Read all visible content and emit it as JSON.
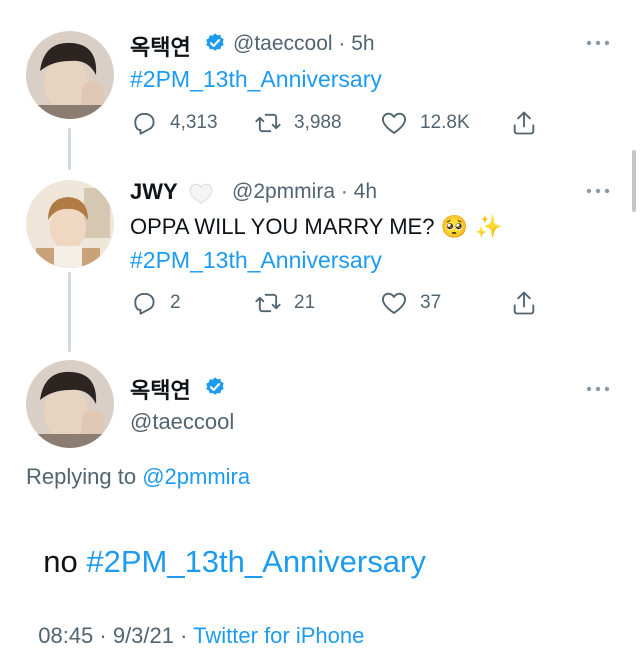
{
  "tweet1": {
    "name": "옥택연",
    "handle_time": "@taeccool · 5h",
    "hashtag": "#2PM_13th_Anniversary",
    "replies": "4,313",
    "retweets": "3,988",
    "likes": "12.8K"
  },
  "tweet2": {
    "name": "JWY",
    "handle_time": "@2pmmira · 4h",
    "text": "OPPA WILL YOU MARRY ME?",
    "emoji": "🥺 ✨",
    "hashtag": "#2PM_13th_Anniversary",
    "replies": "2",
    "retweets": "21",
    "likes": "37"
  },
  "main": {
    "name": "옥택연",
    "handle": "@taeccool",
    "replying_prefix": "Replying to ",
    "replying_handle": "@2pmmira",
    "text_prefix": "no ",
    "hashtag": "#2PM_13th_Anniversary",
    "time": "08:45 · 9/3/21 · ",
    "source": "Twitter for iPhone"
  },
  "colors": {
    "accent": "#1d9bf0",
    "verified": "#1d9bf0",
    "muted": "#536471",
    "text": "#0f1419"
  },
  "icons": [
    "verified-badge-icon",
    "white-heart-icon",
    "more-icon",
    "reply-icon",
    "retweet-icon",
    "like-icon",
    "share-icon"
  ]
}
